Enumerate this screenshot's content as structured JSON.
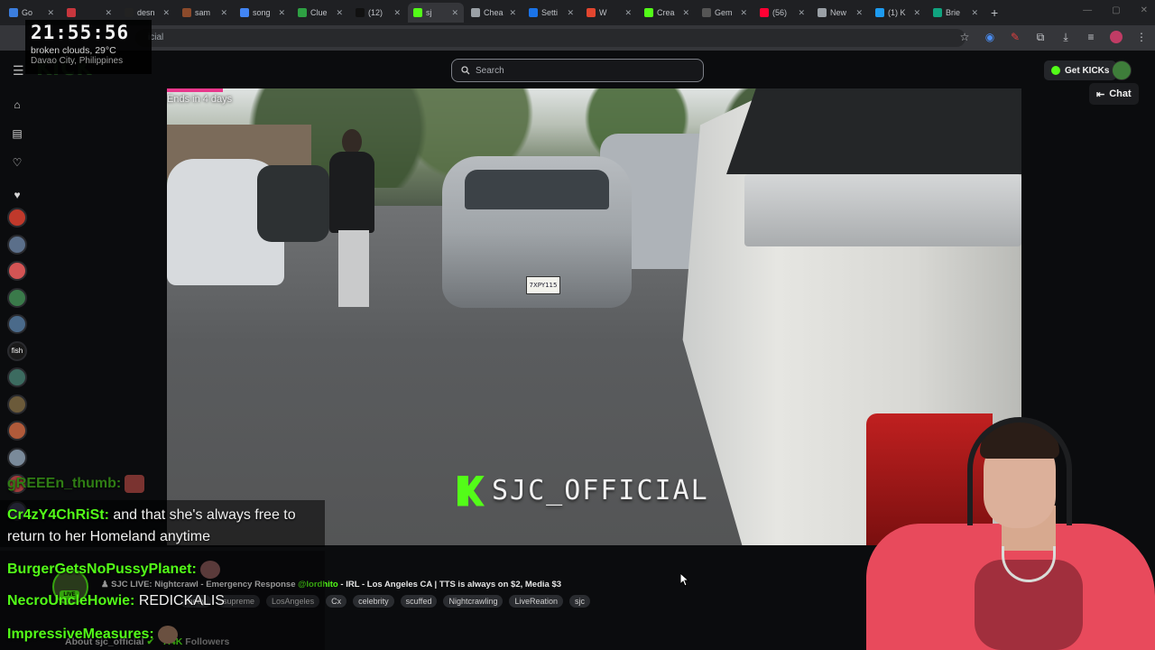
{
  "browser": {
    "tabs": [
      {
        "title": "Go",
        "color": "#3b7ddd"
      },
      {
        "title": "",
        "color": "#c7363d"
      },
      {
        "title": "desn",
        "color": "#222222"
      },
      {
        "title": "sam",
        "color": "#8b4a2b"
      },
      {
        "title": "song",
        "color": "#4285f4"
      },
      {
        "title": "Clue",
        "color": "#2ea043"
      },
      {
        "title": "(12)",
        "color": "#111111"
      },
      {
        "title": "sj",
        "color": "#53fc18",
        "active": true
      },
      {
        "title": "Chea",
        "color": "#9aa0a6"
      },
      {
        "title": "Setti",
        "color": "#1a73e8"
      },
      {
        "title": "W",
        "color": "#e2462f"
      },
      {
        "title": "Crea",
        "color": "#53fc18"
      },
      {
        "title": "Gem",
        "color": "#555555"
      },
      {
        "title": "(56)",
        "color": "#ff0033"
      },
      {
        "title": "New",
        "color": "#9aa0a6"
      },
      {
        "title": "(1) K",
        "color": "#1d9bf0"
      },
      {
        "title": "Brie",
        "color": "#10a37f"
      }
    ],
    "new_tab": "+",
    "address": "icial"
  },
  "clock": {
    "time": "21:55:56",
    "weather": "broken clouds, 29°C",
    "location": "Davao City, Philippines"
  },
  "header": {
    "logo": "KICK",
    "search_placeholder": "Search",
    "get_kicks": "Get KICKs"
  },
  "sidebar": {
    "avatar_colors": [
      "#c0392b",
      "#5b6f8a",
      "#d35454",
      "#3a7a4a",
      "#4a6a8a",
      "#2b2b2b",
      "#3c6b60",
      "#6b5a3a",
      "#b05a3a",
      "#7a8a9a",
      "#a03c3c",
      "#4a4a6a"
    ],
    "fish_label": "fish"
  },
  "video": {
    "ends_label": "Ends in 4 days",
    "watermark": "SJC_OFFICIAL",
    "plate": "7XPY115"
  },
  "chat_toggle": "Chat",
  "stream": {
    "title_prefix": "SJC LIVE: Nightcrawl - Emergency Response",
    "mention": "@lordhito",
    "title_suffix": "- IRL - Los Angeles CA | TTS is always on $2, Media $3",
    "tags": [
      "medy",
      "supreme",
      "LosAngeles",
      "Cx",
      "celebrity",
      "scuffed",
      "Nightcrawling",
      "LiveReation",
      "sjc"
    ],
    "about": "About sjc_official",
    "followers": "7.4K",
    "followers_label": "Followers",
    "live_badge": "LIVE",
    "subscribe_fragment": "e"
  },
  "chat_overlay": {
    "messages": [
      {
        "user": "gREEEn_thumb:",
        "text": "",
        "dim": true
      },
      {
        "user": "Cr4zY4ChRiSt:",
        "text": "and that she's always free to"
      },
      {
        "user": "",
        "text": "return to her Homeland anytime"
      },
      {
        "user": "BurgerGetsNoPussyPlanet:",
        "text": ""
      },
      {
        "user": "NecroUncleHowie:",
        "text": "REDICKALIS"
      },
      {
        "user": "ImpressiveMeasures:",
        "text": ""
      }
    ]
  }
}
